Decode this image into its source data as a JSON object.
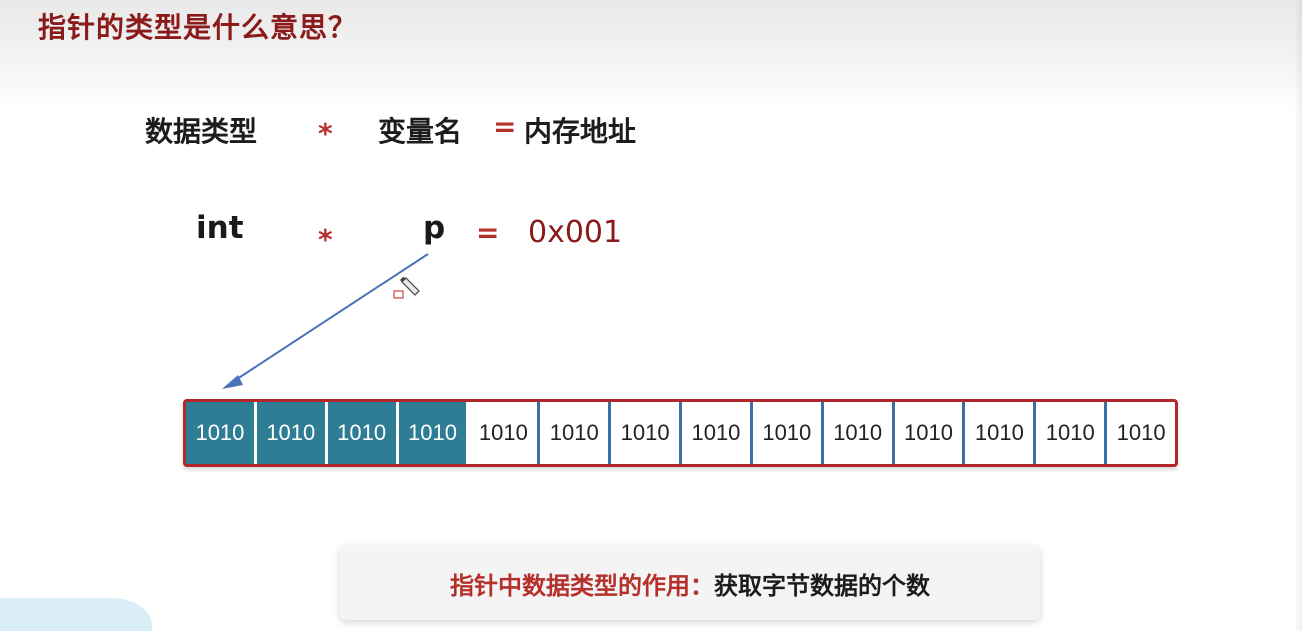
{
  "slide": {
    "title": "指针的类型是什么意思？"
  },
  "formula": {
    "data_type": "数据类型",
    "star": "*",
    "var_name": "变量名",
    "equals": "=",
    "memory_address": "内存地址"
  },
  "example": {
    "type": "int",
    "star": "*",
    "var": "p",
    "equals": "=",
    "address": "0x001"
  },
  "memory": {
    "cells": [
      "1010",
      "1010",
      "1010",
      "1010",
      "1010",
      "1010",
      "1010",
      "1010",
      "1010",
      "1010",
      "1010",
      "1010",
      "1010",
      "1010"
    ],
    "highlighted_count": 4
  },
  "caption": {
    "label": "指针中数据类型的作用：",
    "text": "获取字节数据的个数"
  },
  "colors": {
    "title": "#8b1a1a",
    "highlight_cell": "#2e7d94",
    "memory_border": "#b3262a",
    "arrow": "#4a72b8"
  }
}
